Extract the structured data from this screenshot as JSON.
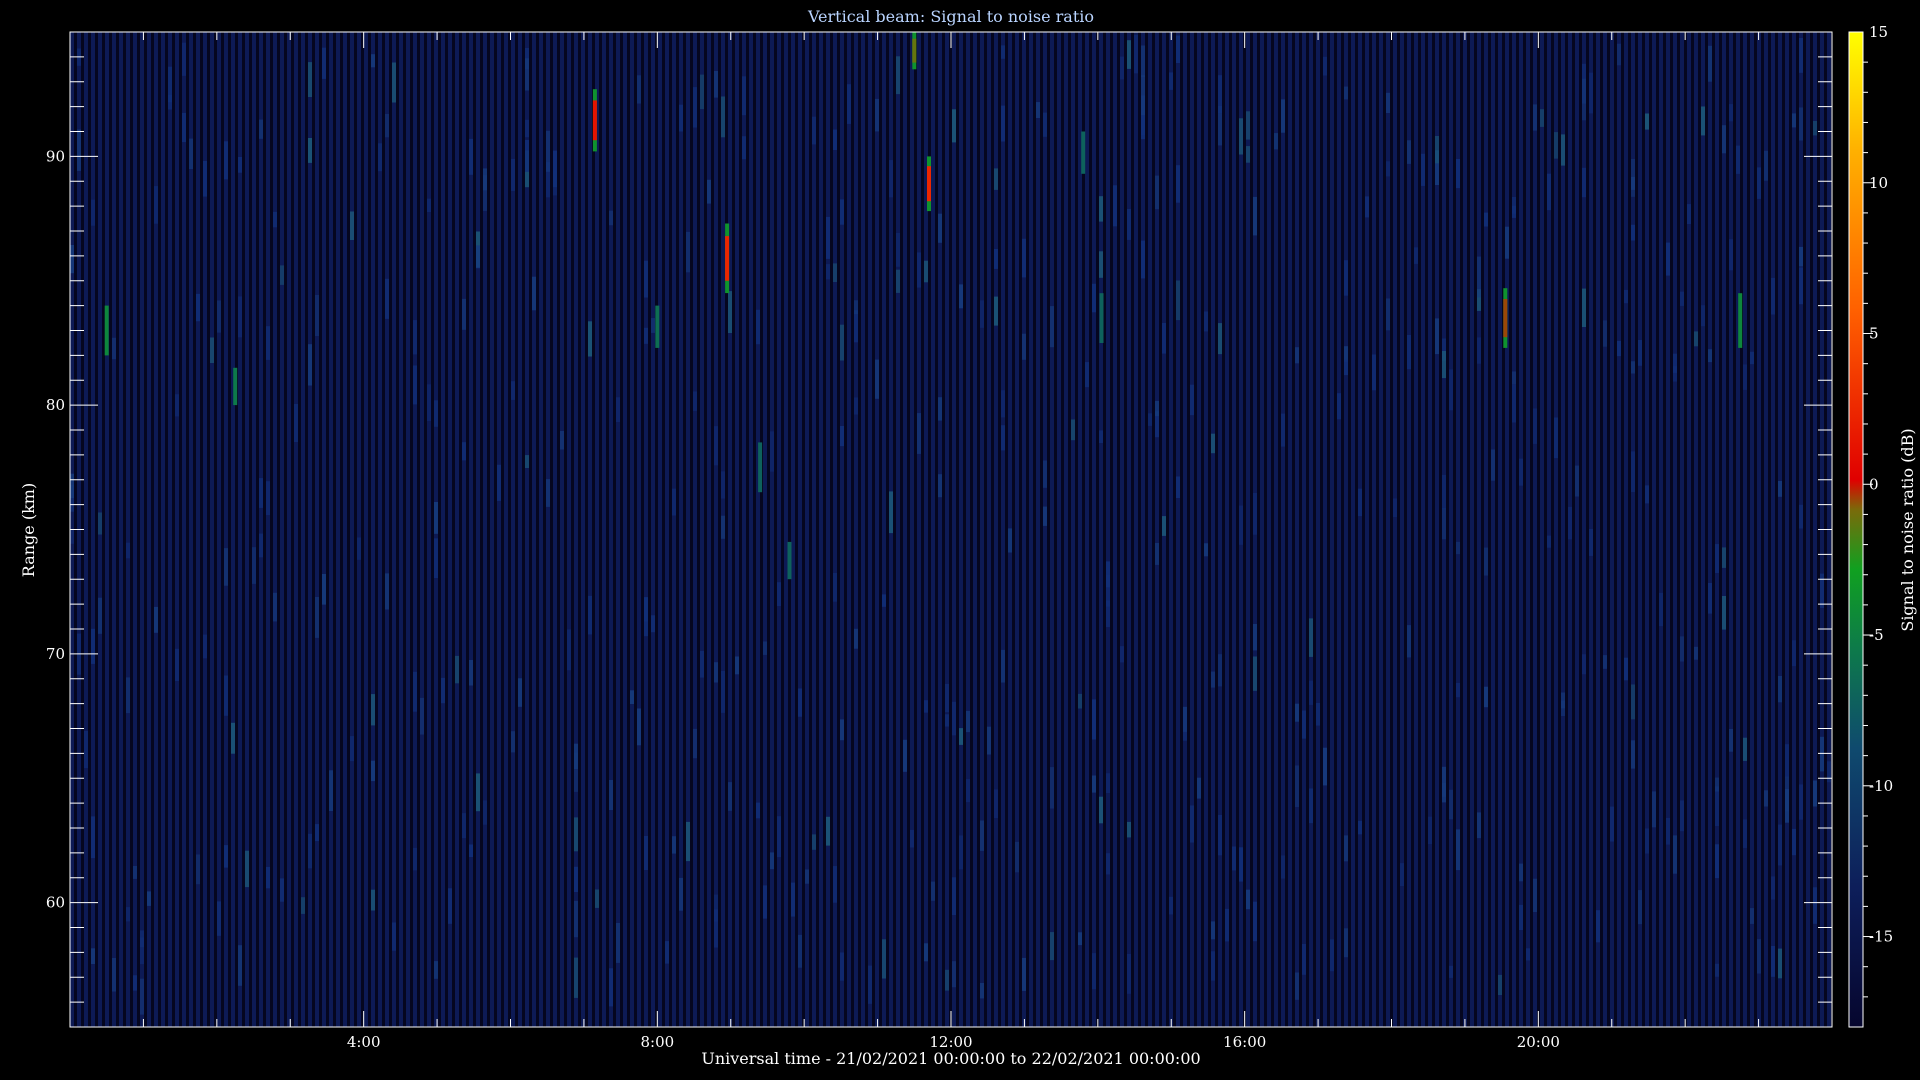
{
  "chart_data": {
    "type": "heatmap",
    "title": "Vertical beam: Signal to noise ratio",
    "xlabel": "Universal time - 21/02/2021 00:00:00 to 22/02/2021 00:00:00",
    "ylabel": "Range (km)",
    "colorbar_label": "Signal to noise ratio (dB)",
    "x_range_hours": [
      0,
      24
    ],
    "y_range_km": [
      55,
      95
    ],
    "color_range_db": [
      -18,
      15
    ],
    "x_ticks": [
      {
        "hour": 4,
        "label": "4:00"
      },
      {
        "hour": 8,
        "label": "8:00"
      },
      {
        "hour": 12,
        "label": "12:00"
      },
      {
        "hour": 16,
        "label": "16:00"
      },
      {
        "hour": 20,
        "label": "20:00"
      }
    ],
    "y_ticks": [
      {
        "km": 60,
        "label": "60"
      },
      {
        "km": 70,
        "label": "70"
      },
      {
        "km": 80,
        "label": "80"
      },
      {
        "km": 90,
        "label": "90"
      }
    ],
    "colorbar_ticks": [
      {
        "db": -15,
        "label": "-15"
      },
      {
        "db": -10,
        "label": "-10"
      },
      {
        "db": -5,
        "label": "-5"
      },
      {
        "db": 0,
        "label": "0"
      },
      {
        "db": 5,
        "label": "5"
      },
      {
        "db": 10,
        "label": "10"
      },
      {
        "db": 15,
        "label": "15"
      }
    ],
    "background_level_db": -15,
    "echoes": [
      {
        "hour": 0.5,
        "range_start": 82.0,
        "range_end": 84.0,
        "snr_db": -6
      },
      {
        "hour": 2.25,
        "range_start": 80.0,
        "range_end": 81.5,
        "snr_db": -7
      },
      {
        "hour": 7.15,
        "range_start": 90.2,
        "range_end": 92.7,
        "snr_db": 1
      },
      {
        "hour": 8.0,
        "range_start": 82.3,
        "range_end": 84.0,
        "snr_db": -8
      },
      {
        "hour": 8.95,
        "range_start": 84.5,
        "range_end": 87.3,
        "snr_db": 2
      },
      {
        "hour": 9.4,
        "range_start": 76.5,
        "range_end": 78.5,
        "snr_db": -9
      },
      {
        "hour": 9.8,
        "range_start": 73.0,
        "range_end": 74.5,
        "snr_db": -9
      },
      {
        "hour": 11.5,
        "range_start": 93.5,
        "range_end": 95.0,
        "snr_db": -2
      },
      {
        "hour": 11.7,
        "range_start": 87.8,
        "range_end": 90.0,
        "snr_db": 2
      },
      {
        "hour": 13.8,
        "range_start": 89.3,
        "range_end": 91.0,
        "snr_db": -9
      },
      {
        "hour": 14.05,
        "range_start": 82.5,
        "range_end": 84.5,
        "snr_db": -9
      },
      {
        "hour": 19.55,
        "range_start": 82.3,
        "range_end": 84.7,
        "snr_db": -1
      },
      {
        "hour": 22.75,
        "range_start": 82.3,
        "range_end": 84.5,
        "snr_db": -6
      }
    ]
  }
}
